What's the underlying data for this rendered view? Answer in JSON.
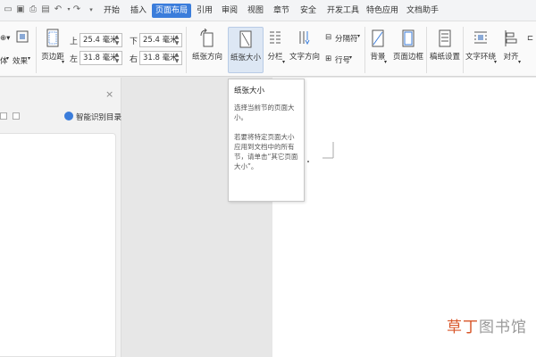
{
  "menu": {
    "tabs": [
      {
        "label": "开始",
        "active": false
      },
      {
        "label": "插入",
        "active": false
      },
      {
        "label": "页面布局",
        "active": true
      },
      {
        "label": "引用",
        "active": false
      },
      {
        "label": "审阅",
        "active": false
      },
      {
        "label": "视图",
        "active": false
      },
      {
        "label": "章节",
        "active": false
      },
      {
        "label": "安全",
        "active": false
      },
      {
        "label": "开发工具",
        "active": false
      },
      {
        "label": "特色应用",
        "active": false
      },
      {
        "label": "文档助手",
        "active": false
      }
    ]
  },
  "ribbon": {
    "theme_label": "效果",
    "theme_partial": "体",
    "margins_label": "页边距",
    "top_label": "上",
    "top_value": "25.4 毫米",
    "bottom_label": "下",
    "bottom_value": "25.4 毫米",
    "left_label": "左",
    "left_value": "31.8 毫米",
    "right_label": "右",
    "right_value": "31.8 毫米",
    "orientation_label": "纸张方向",
    "size_label": "纸张大小",
    "columns_label": "分栏",
    "text_direction_label": "文字方向",
    "separator_label": "分隔符",
    "line_number_label": "行号",
    "background_label": "背景",
    "page_border_label": "页面边框",
    "manuscript_label": "稿纸设置",
    "text_wrap_label": "文字环绕",
    "align_label": "对齐"
  },
  "nav_panel": {
    "close_glyph": "×",
    "smart_toc_label": "智能识别目录"
  },
  "tooltip": {
    "title": "纸张大小",
    "line1": "选择当前节的页面大小。",
    "line2": "若要将特定页面大小应用到文档中的所有节，请单击“其它页面大小”。"
  },
  "watermark": {
    "highlight": "草丁",
    "rest": "图书馆"
  },
  "colors": {
    "accent": "#3b7ddb",
    "watermark_highlight": "#d8572a"
  }
}
